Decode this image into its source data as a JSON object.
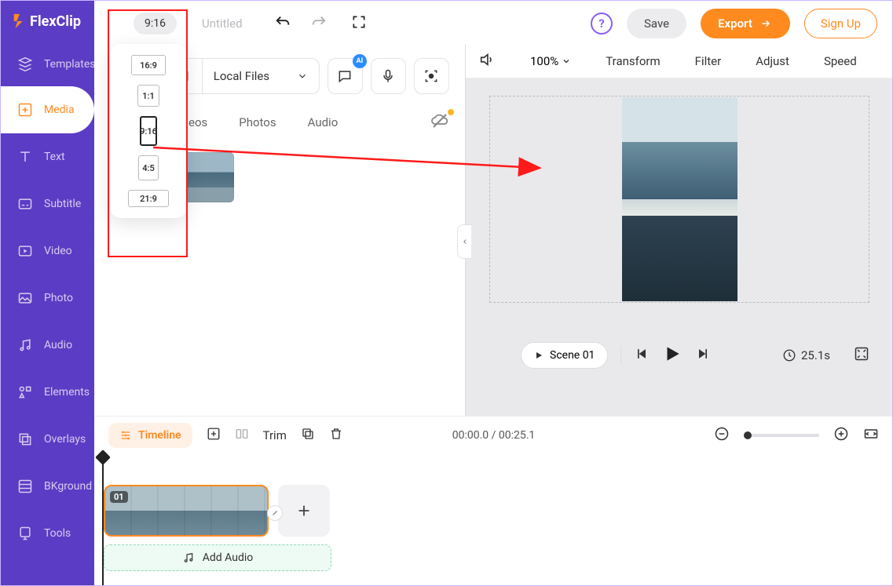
{
  "brand": "FlexClip",
  "sidebar": {
    "items": [
      {
        "label": "Templates"
      },
      {
        "label": "Media"
      },
      {
        "label": "Text"
      },
      {
        "label": "Subtitle"
      },
      {
        "label": "Video"
      },
      {
        "label": "Photo"
      },
      {
        "label": "Audio"
      },
      {
        "label": "Elements"
      },
      {
        "label": "Overlays"
      },
      {
        "label": "BKground"
      },
      {
        "label": "Tools"
      }
    ]
  },
  "topbar": {
    "ratio": "9:16",
    "title": "Untitled",
    "save": "Save",
    "export": "Export",
    "signup": "Sign Up"
  },
  "ratioOptions": {
    "r169": "16:9",
    "r11": "1:1",
    "r916": "9:16",
    "r45": "4:5",
    "r219": "21:9"
  },
  "mediaPanel": {
    "localFiles": "Local Files",
    "aiBadge": "AI",
    "tabs": {
      "videos": "eos",
      "photos": "Photos",
      "audio": "Audio"
    }
  },
  "preview": {
    "zoom": "100%",
    "transform": "Transform",
    "filter": "Filter",
    "adjust": "Adjust",
    "speed": "Speed",
    "scene": "Scene 01",
    "duration": "25.1s"
  },
  "timelineBar": {
    "timeline": "Timeline",
    "trim": "Trim",
    "time": "00:00.0 / 00:25.1"
  },
  "track": {
    "clipNum": "01",
    "addAudio": "Add Audio"
  }
}
